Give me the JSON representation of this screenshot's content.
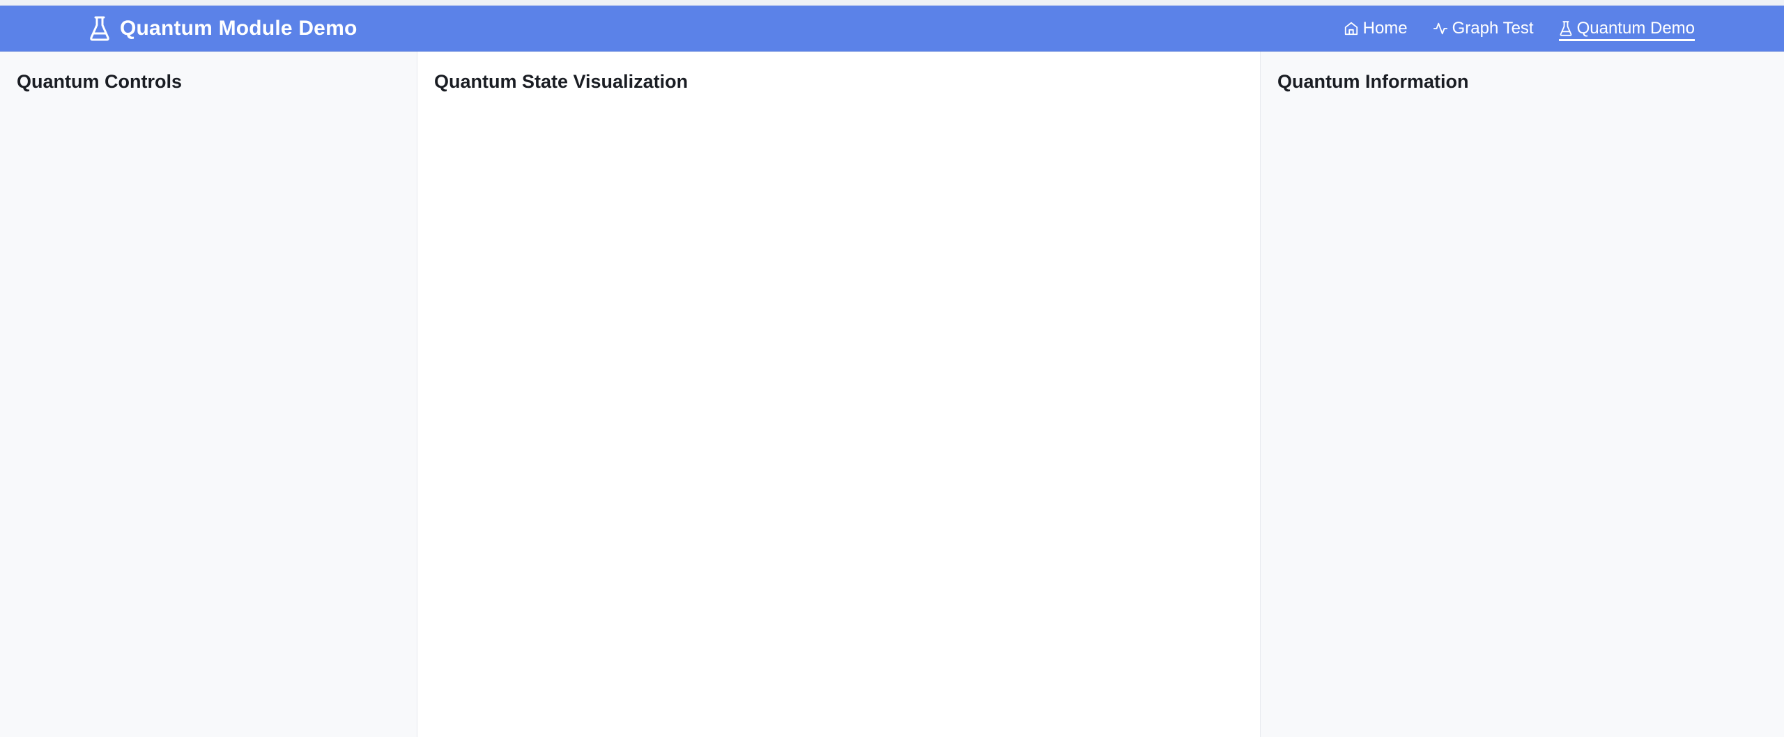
{
  "app": {
    "title": "Quantum Module Demo",
    "brand_icon": "flask-icon"
  },
  "nav": {
    "items": [
      {
        "label": "Home",
        "icon": "home-icon",
        "active": false
      },
      {
        "label": "Graph Test",
        "icon": "activity-icon",
        "active": false
      },
      {
        "label": "Quantum Demo",
        "icon": "flask-icon",
        "active": true
      }
    ]
  },
  "panels": {
    "left": {
      "title": "Quantum Controls"
    },
    "center": {
      "title": "Quantum State Visualization"
    },
    "right": {
      "title": "Quantum Information"
    }
  },
  "colors": {
    "navbar": "#5b82e8",
    "side_panel_bg": "#f8f9fb",
    "center_panel_bg": "#ffffff",
    "heading_text": "#1a1d23"
  }
}
